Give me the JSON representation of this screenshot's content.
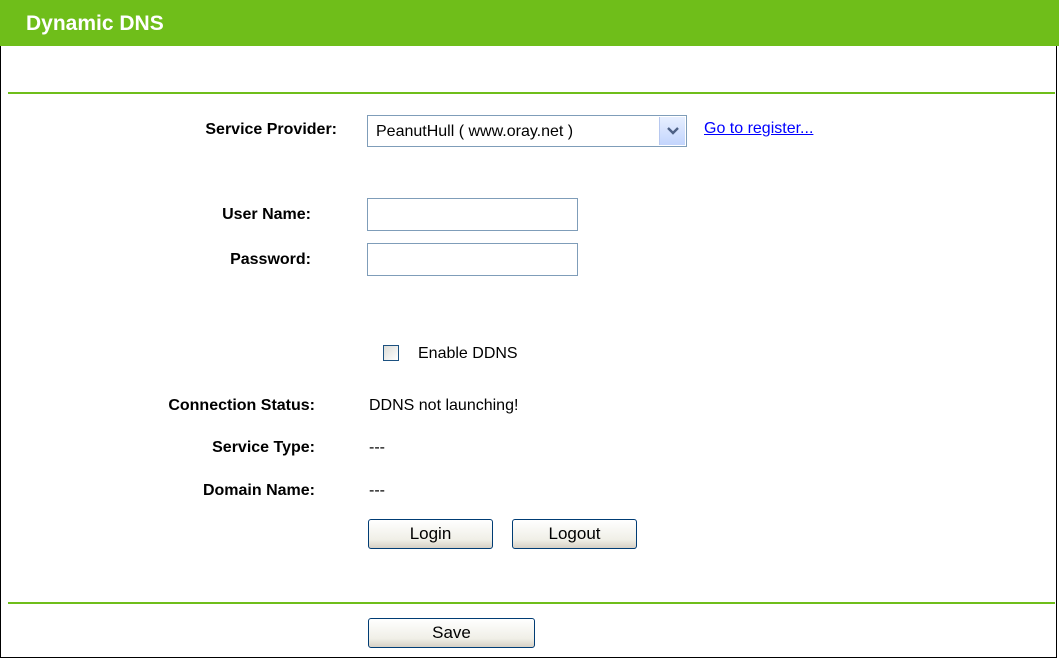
{
  "header": {
    "title": "Dynamic DNS"
  },
  "form": {
    "service_provider_label": "Service Provider:",
    "service_provider_value": "PeanutHull ( www.oray.net )",
    "register_link": "Go to register...",
    "username_label": "User Name:",
    "username_value": "",
    "password_label": "Password:",
    "password_value": "",
    "enable_ddns_label": "Enable DDNS",
    "enable_ddns_checked": false,
    "connection_status_label": "Connection Status:",
    "connection_status_value": "DDNS not launching!",
    "service_type_label": "Service Type:",
    "service_type_value": "---",
    "domain_name_label": "Domain Name:",
    "domain_name_value": "---",
    "login_button": "Login",
    "logout_button": "Logout"
  },
  "footer": {
    "save_button": "Save"
  },
  "colors": {
    "accent": "#6fbe1a",
    "link": "#0000ff"
  },
  "icons": {
    "dropdown": "chevron-down-icon"
  }
}
